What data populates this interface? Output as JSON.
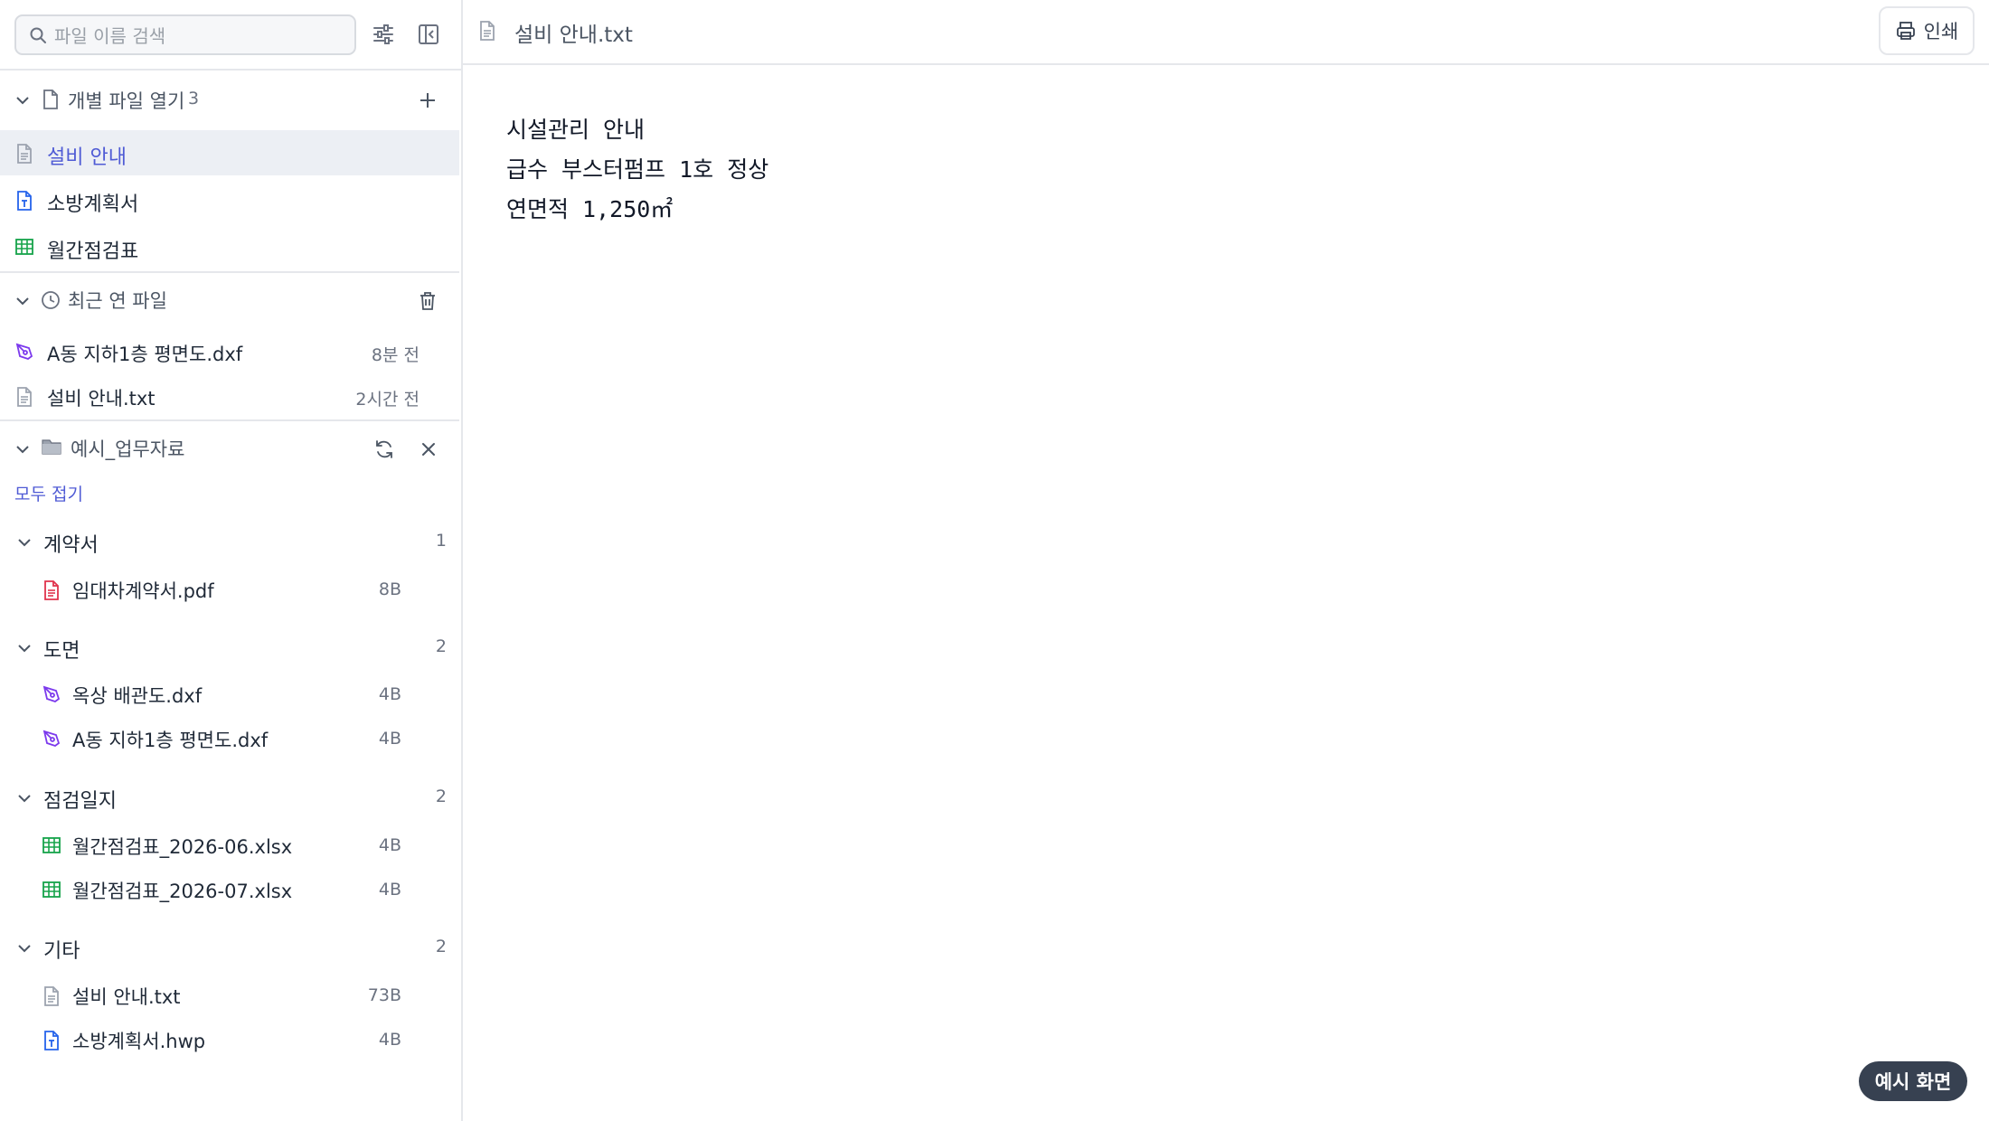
{
  "search": {
    "placeholder": "파일 이름 검색"
  },
  "open_files": {
    "title": "개별 파일 열기",
    "count": "3",
    "items": [
      {
        "label": "설비 안내",
        "icon": "text-file-icon",
        "active": true
      },
      {
        "label": "소방계획서",
        "icon": "hwp-file-icon"
      },
      {
        "label": "월간점검표",
        "icon": "spreadsheet-icon"
      }
    ]
  },
  "recent": {
    "title": "최근 연 파일",
    "items": [
      {
        "label": "A동 지하1층 평면도.dxf",
        "time": "8분 전",
        "icon": "cad-file-icon"
      },
      {
        "label": "설비 안내.txt",
        "time": "2시간 전",
        "icon": "text-file-icon"
      }
    ]
  },
  "folder": {
    "title": "예시_업무자료",
    "collapse_all": "모두 접기",
    "groups": [
      {
        "name": "계약서",
        "count": "1",
        "files": [
          {
            "name": "임대차계약서.pdf",
            "size": "8B",
            "icon": "pdf-file-icon"
          }
        ]
      },
      {
        "name": "도면",
        "count": "2",
        "files": [
          {
            "name": "옥상 배관도.dxf",
            "size": "4B",
            "icon": "cad-file-icon"
          },
          {
            "name": "A동 지하1층 평면도.dxf",
            "size": "4B",
            "icon": "cad-file-icon"
          }
        ]
      },
      {
        "name": "점검일지",
        "count": "2",
        "files": [
          {
            "name": "월간점검표_2026-06.xlsx",
            "size": "4B",
            "icon": "spreadsheet-icon"
          },
          {
            "name": "월간점검표_2026-07.xlsx",
            "size": "4B",
            "icon": "spreadsheet-icon"
          }
        ]
      },
      {
        "name": "기타",
        "count": "2",
        "files": [
          {
            "name": "설비 안내.txt",
            "size": "73B",
            "icon": "text-file-icon"
          },
          {
            "name": "소방계획서.hwp",
            "size": "4B",
            "icon": "hwp-file-icon"
          }
        ]
      }
    ]
  },
  "document": {
    "title": "설비 안내.txt",
    "print_label": "인쇄",
    "lines": [
      "시설관리 안내",
      "급수 부스터펌프 1호 정상",
      "연면적 1,250㎡"
    ]
  },
  "badge": "예시 화면",
  "colors": {
    "accent": "#4f5bd5",
    "active_bg": "#eceff4",
    "pdf": "#e0334c",
    "cad": "#7c3aed",
    "sheet": "#16a34a",
    "hwp": "#2563eb",
    "badge_bg": "#374151"
  }
}
